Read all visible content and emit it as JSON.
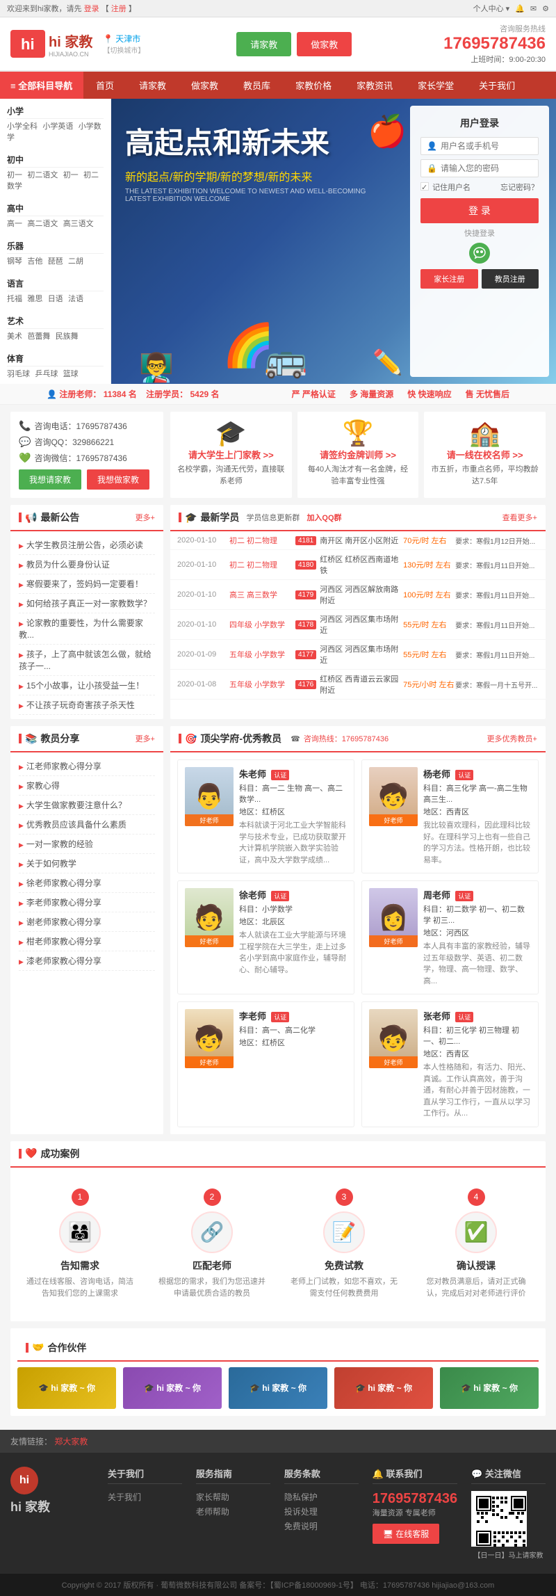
{
  "topbar": {
    "left_text": "欢迎来到hi家教，请先",
    "login_link": "登录",
    "register_link": "注册",
    "right_items": [
      "个人中心▾",
      "🔔",
      "📧",
      "⚙"
    ]
  },
  "header": {
    "logo_text": "hi 家教",
    "logo_sub": "HIJIAJIAO.CN",
    "city": "天津市",
    "city_sub": "【切换城市】",
    "btn_qingjia": "请家教",
    "btn_zuojia": "做家教",
    "hotline_label": "咨询服务热线",
    "hotline_num": "17695787436",
    "hotline_time": "上班时间：9:00-20:30"
  },
  "nav": {
    "all_label": "≡ 全部科目导航",
    "items": [
      "首页",
      "请家教",
      "做家教",
      "教员库",
      "家教价格",
      "家教资讯",
      "家长学堂",
      "关于我们"
    ]
  },
  "sidebar": {
    "categories": [
      {
        "title": "小学",
        "items": [
          "小学全科",
          "小学英语",
          "小学数学"
        ]
      },
      {
        "title": "初中",
        "items": [
          "初一",
          "初二语文",
          "初一",
          "初二数学"
        ]
      },
      {
        "title": "高中",
        "items": [
          "高一",
          "高二语文",
          "高三语文"
        ]
      },
      {
        "title": "乐器",
        "items": [
          "钢琴",
          "吉他",
          "琵琶",
          "二胡"
        ]
      },
      {
        "title": "语言",
        "items": [
          "托福",
          "雅思",
          "日语",
          "法语"
        ]
      },
      {
        "title": "艺术",
        "items": [
          "美术",
          "芭蕾舞",
          "民族舞"
        ]
      },
      {
        "title": "体育",
        "items": [
          "羽毛球",
          "乒乓球",
          "篮球"
        ]
      }
    ]
  },
  "hero": {
    "title": "高起点和新未来",
    "subtitle": "新的起点/新的学期/新的梦想/新的未来",
    "small": "THE LATEST EXHIBITION WELCOME TO NEWEST AND WELL-BECOMING LATEST EXHIBITION WELCOME"
  },
  "login": {
    "title": "用户登录",
    "username_placeholder": "用户名或手机号",
    "password_placeholder": "请输入您的密码",
    "remember_me": "记住用户名",
    "forgot": "忘记密码？",
    "login_btn": "登 录",
    "quick_login": "快捷登录",
    "wechat_hint": "微信",
    "reg_jiazhu": "家长注册",
    "reg_jiaoshi": "教员注册"
  },
  "stats": {
    "registered_teachers_label": "注册老师：",
    "registered_teachers_num": "11384",
    "registered_teachers_unit": "名",
    "registered_students_label": "注册学员：",
    "registered_students_num": "5429",
    "registered_students_unit": "名",
    "features": [
      "严格认证",
      "海量资源",
      "快速响应",
      "无忧售后"
    ]
  },
  "contact": {
    "phone": "咨询电话：17695787436",
    "qq": "咨询QQ：329866221",
    "wechat": "咨询微信：17695787436",
    "btn_qingjia": "我想请家教",
    "btn_zuojia": "我想做家教"
  },
  "promos": [
    {
      "icon": "🎓",
      "title": "请大学生上门家教 >>",
      "desc": "名校学霸，沟通无代劳，直接联系老师"
    },
    {
      "icon": "🏆",
      "title": "请签约金牌训师 >>",
      "desc": "每40人淘汰才有一名金牌，经验丰富专业性强"
    },
    {
      "icon": "🏫",
      "title": "请一线在校名师 >>",
      "desc": "市五折，市重点名师，平均教龄达7.5年"
    }
  ],
  "announcements": {
    "title": "最新公告",
    "more": "更多+",
    "items": [
      "大学生教员注册公告，必须必读",
      "教员为什么要身份认证",
      "寒假要来了，签妈妈一定要看！",
      "如何给孩子真正一对一家教数学？",
      "论家教的重要性，为什么需要家教...",
      "孩子，上了高中就该怎么做，就给孩子一...",
      "15个小故事，让小孩受益一生！",
      "不让孩子玩奇奇害孩子杀天性"
    ]
  },
  "latest_students": {
    "title": "最新学员",
    "subtitle": "学员信息更新群",
    "qq_group": "加入QQ群",
    "more": "查看更多+",
    "items": [
      {
        "date": "2020-01-10",
        "grade": "初二 初二物理",
        "num": "4181",
        "location": "南开区 南开区小区附近",
        "price": "70元/时 左右",
        "req": "要求：寒假1月12日开始..."
      },
      {
        "date": "2020-01-10",
        "grade": "初二 初二物理",
        "num": "4180",
        "location": "红桥区 红桥区西南道地铁",
        "price": "130元/时 左右",
        "req": "要求：寒假1月11日开始..."
      },
      {
        "date": "2020-01-10",
        "grade": "高三 高三数学",
        "num": "4179",
        "location": "河西区 河西区解放南路附近",
        "price": "100元/时 左右",
        "req": "要求：寒假1月11日开始..."
      },
      {
        "date": "2020-01-10",
        "grade": "四年级 小学数学",
        "num": "4178",
        "location": "河西区 河西区集市场附近",
        "price": "55元/时 左右",
        "req": "要求：寒假1月11日开始..."
      },
      {
        "date": "2020-01-09",
        "grade": "五年级 小学数学",
        "num": "4177",
        "location": "河西区 河西区集市场附近",
        "price": "55元/时 左右",
        "req": "要求：寒假1月11日开始..."
      },
      {
        "date": "2020-01-08",
        "grade": "五年级 小学数学",
        "num": "4176",
        "location": "红桥区 西青道云云家园附近",
        "price": "75元/小时 左右",
        "req": "要求：寒假一月十五号开..."
      }
    ]
  },
  "teacher_share": {
    "title": "教员分享",
    "more": "更多+",
    "items": [
      "江老师家教心得分享",
      "家教心得",
      "大学生做家教要注意什么？",
      "优秀教员应该具备什么素质",
      "一对一家教的经验",
      "关于如何教学",
      "徐老师家教心得分享",
      "李老师家教心得分享",
      "谢老师家教心得分享",
      "柑老师家教心得分享",
      "漆老师家教心得分享"
    ]
  },
  "top_teachers": {
    "title": "顶尖学府-优秀教员",
    "hotline": "咨询热线：17695787436",
    "more": "更多优秀教员+",
    "teachers": [
      {
        "name": "朱老师",
        "cert": "认证",
        "subjects": "科目：高一二 生物 高一、高二数学...",
        "area": "地区：红桥区",
        "desc": "本科就读于河北工业大学智能科学与技术专业，已成功获取蒙开大计算机学院嵌入数学实验验证，高中及大学数学成绩..."
      },
      {
        "name": "杨老师",
        "cert": "认证",
        "subjects": "科目：高三化学 高一-高二生物 高三生...",
        "area": "地区：西青区",
        "desc": "我比较喜欢理科，因此理科比较好。在理科学习上也有一些自己的学习方法。性格开朗，也比较易率。"
      },
      {
        "name": "徐老师",
        "cert": "认证",
        "subjects": "科目：小学数学",
        "area": "地区：北辰区",
        "desc": "本人就读在工业大学能源与环境工程学院在大三学生，走上过多名小学到高中家庭作业，辅导耐心、耐心辅导。"
      },
      {
        "name": "周老师",
        "cert": "认证",
        "subjects": "科目：初二数学 初一、初二数学 初三...",
        "area": "地区：河西区",
        "desc": "本人具有丰富的家教经验，辅导过五年级数学、英语、初二数学，物理、高一物理、数学、高..."
      },
      {
        "name": "李老师",
        "cert": "认证",
        "subjects": "科目：高一、高二化学",
        "area": "地区：红桥区",
        "desc": ""
      },
      {
        "name": "张老师",
        "cert": "认证",
        "subjects": "科目：初三化学 初三物理 初一、初二...",
        "area": "地区：西青区",
        "desc": "本人性格随和，有活力、阳光、真诚。工作认真高效，善于沟通，有耐心并善于因材施教，一直从学习工作行，一直从以学习工作行。从..."
      }
    ]
  },
  "success_cases": {
    "title": "成功案例",
    "items": [
      {
        "num": "1",
        "icon": "👨‍👩‍👧",
        "title": "告知需求",
        "desc": "通过在线客服、咨询电话，简洁告知我们您的上课需求"
      },
      {
        "num": "2",
        "icon": "🔗",
        "title": "匹配老师",
        "desc": "根据您的需求，我们为您迅速并申请最优质合适的教员"
      },
      {
        "num": "3",
        "icon": "📝",
        "title": "免费试教",
        "desc": "老师上门试教，如您不喜欢，无需支付任何教费费用"
      },
      {
        "num": "4",
        "icon": "✅",
        "title": "确认授课",
        "desc": "您对教员满意后，请对正式确认，完成后对对老师进行评价"
      }
    ]
  },
  "partners": {
    "title": "合作伙伴",
    "items": [
      {
        "label": "hi 家教 ~ 你",
        "bg": "#c8a000"
      },
      {
        "label": "hi 家教 ~ 你",
        "bg": "#8a4ab0"
      },
      {
        "label": "hi 家教 ~ 你",
        "bg": "#2a6a9a"
      },
      {
        "label": "hi 家教 ~ 你",
        "bg": "#c04030"
      },
      {
        "label": "hi 家教 ~ 你",
        "bg": "#3a8a4a"
      }
    ]
  },
  "footer_links": {
    "label": "友情链接：",
    "items": [
      "郑大家教"
    ]
  },
  "footer": {
    "cols": [
      {
        "title": "关于我们",
        "links": [
          "关于我们"
        ]
      },
      {
        "title": "服务指南",
        "links": [
          "家长帮助",
          "老师帮助"
        ]
      },
      {
        "title": "服务条款",
        "links": [
          "隐私保护",
          "投诉处理",
          "免费说明"
        ]
      },
      {
        "title": "联系我们",
        "phone": "17695787436",
        "phone_sub": "海量资源  专属老师",
        "online_btn": "在线客服"
      },
      {
        "title": "关注微信",
        "qr_hint": "扫二维码",
        "daily": "日一日 马上请家教"
      }
    ]
  },
  "copyright": {
    "text": "Copyright © 2017 版权所有 · 葡萄微数科技有限公司  备案号：【蜀ICP备18000969-1号】  电话：17695787436  hijiajiao@163.com"
  }
}
